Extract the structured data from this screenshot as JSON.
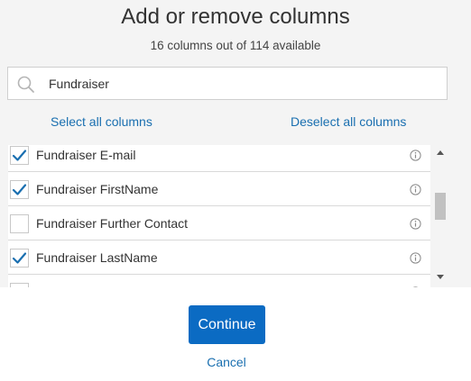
{
  "dialog": {
    "title": "Add or remove columns",
    "subtitle": "16 columns out of 114 available"
  },
  "search": {
    "value": "Fundraiser",
    "icon": "search-icon"
  },
  "links": {
    "select_all": "Select all columns",
    "deselect_all": "Deselect all columns"
  },
  "columns": [
    {
      "label": "Fundraiser E-mail",
      "checked": true
    },
    {
      "label": "Fundraiser FirstName",
      "checked": true
    },
    {
      "label": "Fundraiser Further Contact",
      "checked": false
    },
    {
      "label": "Fundraiser LastName",
      "checked": true
    },
    {
      "label": "",
      "checked": false
    }
  ],
  "actions": {
    "continue_label": "Continue",
    "cancel_label": "Cancel"
  },
  "colors": {
    "accent": "#0b6bc3",
    "link": "#1a6fb0",
    "check": "#1a6fb0",
    "panel_bg": "#f4f4f4"
  }
}
